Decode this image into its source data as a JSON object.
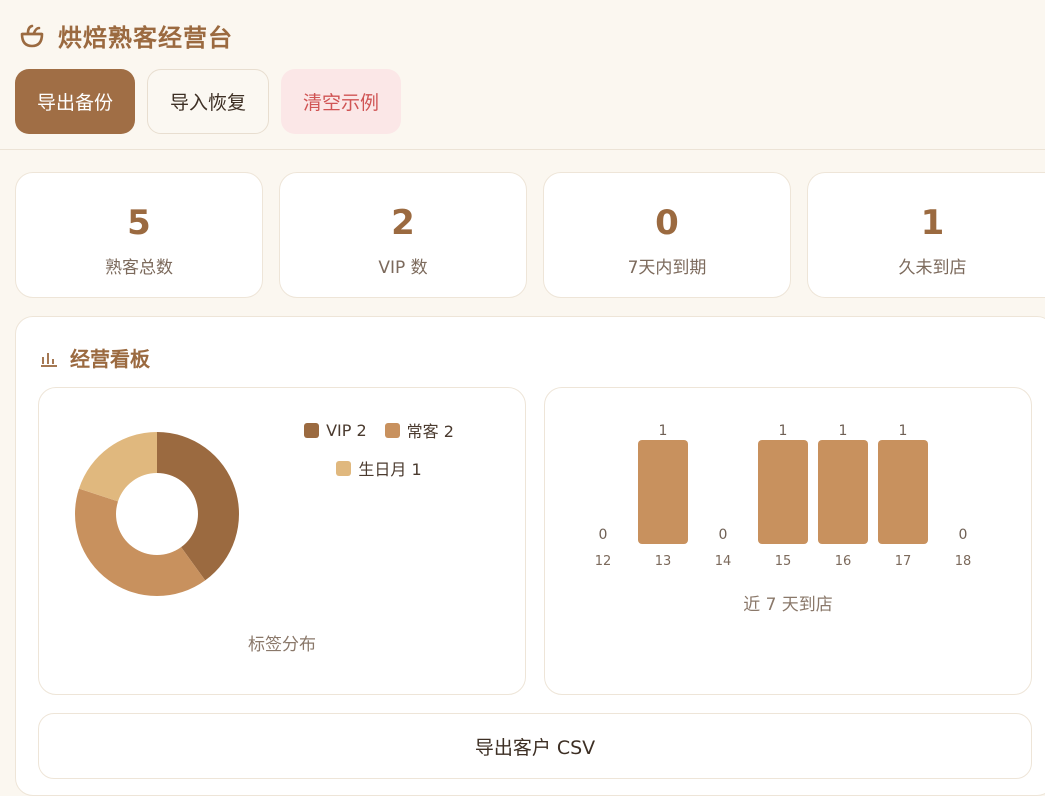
{
  "app": {
    "title": "烘焙熟客经营台",
    "logo_icon": "cake-icon"
  },
  "toolbar": {
    "export_backup_label": "导出备份",
    "import_restore_label": "导入恢复",
    "clear_demo_label": "清空示例"
  },
  "stats": [
    {
      "value": "5",
      "label": "熟客总数"
    },
    {
      "value": "2",
      "label": "VIP 数"
    },
    {
      "value": "0",
      "label": "7天内到期"
    },
    {
      "value": "1",
      "label": "久未到店"
    }
  ],
  "board": {
    "title": "经营看板",
    "title_icon": "bar-chart-icon",
    "export_csv_label": "导出客户 CSV"
  },
  "colors": {
    "accent": "#a06e45",
    "vip": "#9b6a40",
    "regular": "#c8915e",
    "birthday": "#e0b87e"
  },
  "chart_data": [
    {
      "type": "pie",
      "title": "标签分布",
      "labels": [
        "VIP",
        "常客",
        "生日月"
      ],
      "values": [
        2,
        2,
        1
      ],
      "legend": [
        "VIP 2",
        "常客 2",
        "生日月 1"
      ],
      "colors": [
        "#9b6a40",
        "#c8915e",
        "#e0b87e"
      ],
      "legend_position": "top-right"
    },
    {
      "type": "bar",
      "title": "近 7 天到店",
      "categories": [
        "12",
        "13",
        "14",
        "15",
        "16",
        "17",
        "18"
      ],
      "values": [
        0,
        1,
        0,
        1,
        1,
        1,
        0
      ],
      "ylim": [
        0,
        1
      ],
      "color": "#c8915e"
    }
  ]
}
